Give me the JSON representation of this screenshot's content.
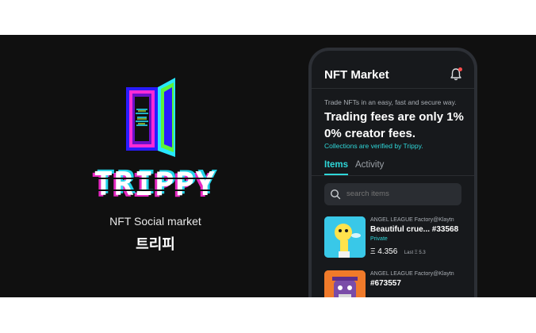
{
  "brand": {
    "wordmark": "TRIPPY",
    "tagline": "NFT Social market",
    "korean_name": "트리피"
  },
  "app": {
    "title": "NFT Market",
    "intro": "Trade NFTs in an easy, fast and secure way.",
    "headline": "Trading fees are only 1% 0% creator fees.",
    "verified_note": "Collections are verified by Trippy.",
    "tabs": [
      {
        "label": "Items",
        "active": true
      },
      {
        "label": "Activity",
        "active": false
      }
    ],
    "search": {
      "placeholder": "search items"
    },
    "items": [
      {
        "collection": "ANGEL LEAGUE Factory@Klaytn",
        "name": "Beautiful crue... #33568",
        "status": "Private",
        "price": "Ξ 4.356",
        "last_sale": "Last Ξ 5.3"
      },
      {
        "collection": "ANGEL LEAGUE Factory@Klaytn",
        "name": "#673557"
      }
    ]
  },
  "colors": {
    "background": "#101010",
    "accent": "#2fd7d9",
    "notification": "#ff4d4d"
  }
}
